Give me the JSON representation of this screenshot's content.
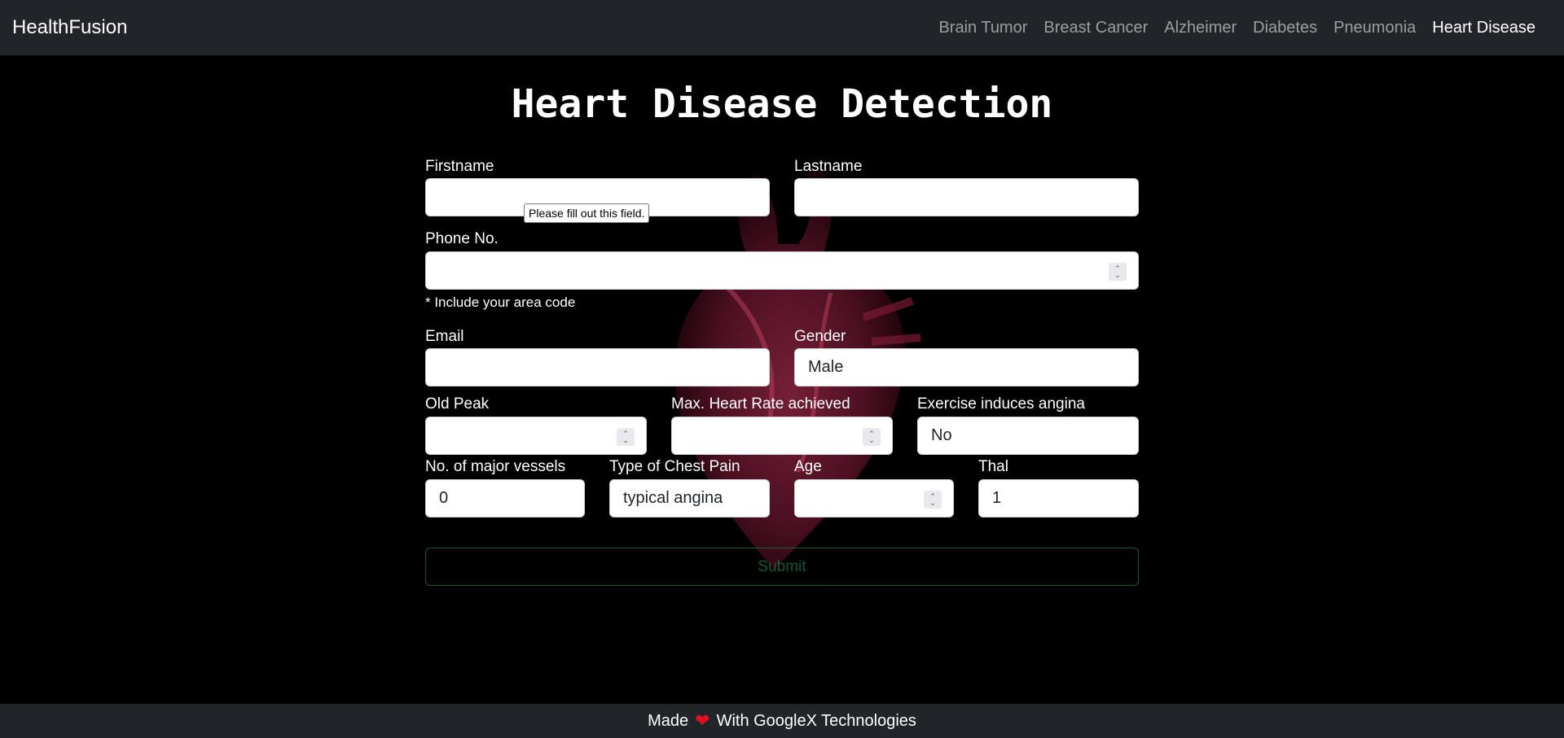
{
  "navbar": {
    "brand": "HealthFusion",
    "links": [
      "Brain Tumor",
      "Breast Cancer",
      "Alzheimer",
      "Diabetes",
      "Pneumonia",
      "Heart Disease"
    ],
    "active": "Heart Disease"
  },
  "page": {
    "title": "Heart Disease Detection"
  },
  "form": {
    "firstname_label": "Firstname",
    "lastname_label": "Lastname",
    "phone_label": "Phone No.",
    "phone_help": "* Include your area code",
    "email_label": "Email",
    "gender_label": "Gender",
    "gender_value": "Male",
    "oldpeak_label": "Old Peak",
    "maxhr_label": "Max. Heart Rate achieved",
    "angina_label": "Exercise induces angina",
    "angina_value": "No",
    "vessels_label": "No. of major vessels",
    "vessels_value": "0",
    "chestpain_label": "Type of Chest Pain",
    "chestpain_value": "typical angina",
    "age_label": "Age",
    "thal_label": "Thal",
    "thal_value": "1",
    "submit_label": "Submit"
  },
  "tooltip": {
    "text": "Please fill out this field."
  },
  "footer": {
    "made": "Made",
    "with": "With GoogleX Technologies",
    "icon": "heart-icon"
  },
  "colors": {
    "navbar": "#212529",
    "submit": "#198754",
    "heart": "#e0101f"
  }
}
